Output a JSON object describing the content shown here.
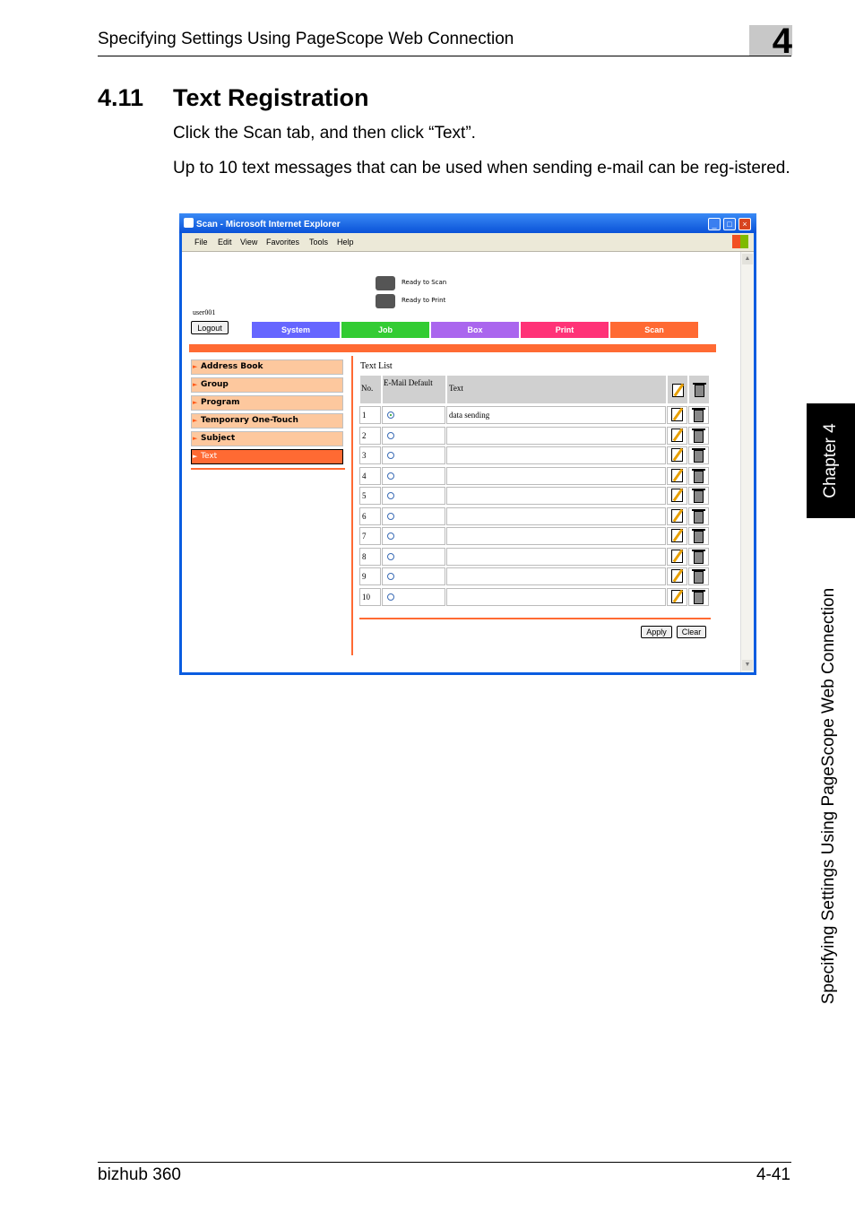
{
  "header": {
    "title": "Specifying Settings Using PageScope Web Connection",
    "chapter_number": "4"
  },
  "section": {
    "number": "4.11",
    "title": "Text Registration"
  },
  "paragraphs": [
    "Click the Scan tab, and then click “Text”.",
    "Up to 10 text messages that can be used when sending e-mail can be reg-istered."
  ],
  "side": {
    "chapter_tab": "Chapter 4",
    "running_title": "Specifying Settings Using PageScope Web Connection"
  },
  "footer": {
    "left": "bizhub 360",
    "right": "4-41"
  },
  "screenshot": {
    "window_title": "Scan - Microsoft Internet Explorer",
    "menu": [
      "File",
      "Edit",
      "View",
      "Favorites",
      "Tools",
      "Help"
    ],
    "status": [
      "Ready to Scan",
      "Ready to Print"
    ],
    "user": "user001",
    "logout_label": "Logout",
    "tabs": [
      {
        "label": "System",
        "color": "#6666ff"
      },
      {
        "label": "Job",
        "color": "#33cc33"
      },
      {
        "label": "Box",
        "color": "#aa66ee"
      },
      {
        "label": "Print",
        "color": "#ff3377"
      },
      {
        "label": "Scan",
        "color": "#ff6a33"
      }
    ],
    "left_menu": [
      "Address Book",
      "Group",
      "Program",
      "Temporary One-Touch",
      "Subject",
      "Text"
    ],
    "active_menu": "Text",
    "list_title": "Text List",
    "columns": {
      "no": "No.",
      "email_default": "E-Mail Default",
      "text": "Text"
    },
    "rows": [
      {
        "no": "1",
        "default": true,
        "text": "data sending"
      },
      {
        "no": "2",
        "default": false,
        "text": ""
      },
      {
        "no": "3",
        "default": false,
        "text": ""
      },
      {
        "no": "4",
        "default": false,
        "text": ""
      },
      {
        "no": "5",
        "default": false,
        "text": ""
      },
      {
        "no": "6",
        "default": false,
        "text": ""
      },
      {
        "no": "7",
        "default": false,
        "text": ""
      },
      {
        "no": "8",
        "default": false,
        "text": ""
      },
      {
        "no": "9",
        "default": false,
        "text": ""
      },
      {
        "no": "10",
        "default": false,
        "text": ""
      }
    ],
    "apply_label": "Apply",
    "clear_label": "Clear"
  }
}
